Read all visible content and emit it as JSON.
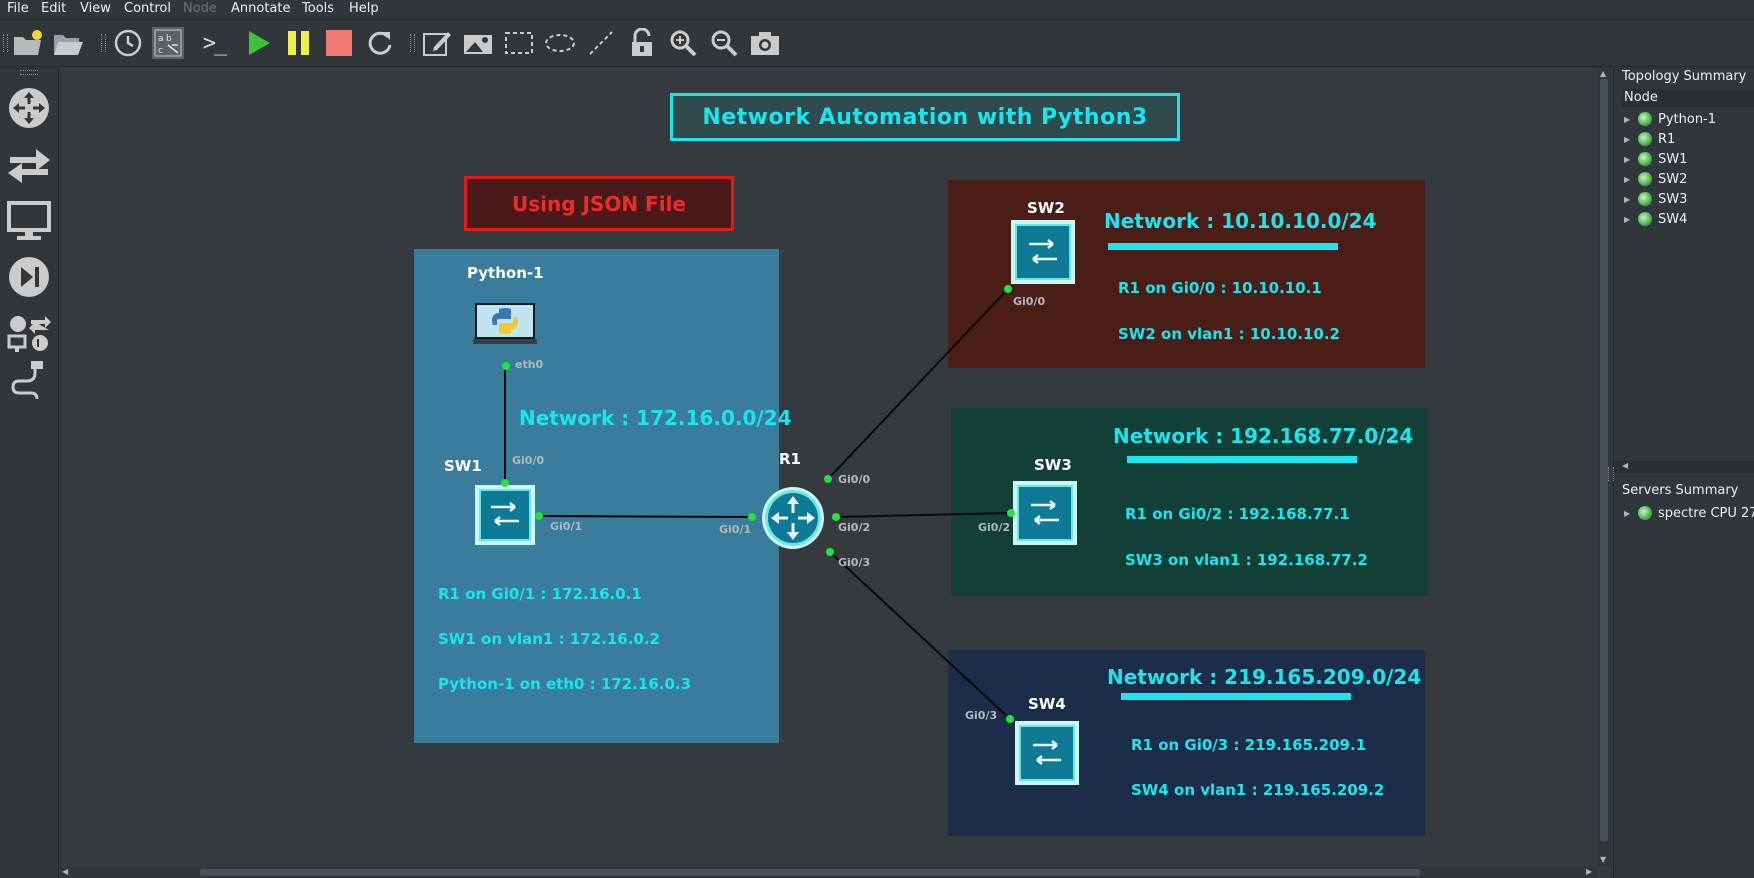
{
  "menu": {
    "file": "File",
    "edit": "Edit",
    "view": "View",
    "control": "Control",
    "node": "Node",
    "annotate": "Annotate",
    "tools": "Tools",
    "help": "Help"
  },
  "toolbar": {
    "console_label": ">_"
  },
  "diagram": {
    "main_title": "Network Automation with Python3",
    "subtitle": "Using JSON File",
    "zone1": {
      "network": "Network : 172.16.0.0/24",
      "line1": "R1 on Gi0/1 : 172.16.0.1",
      "line2": "SW1 on vlan1 : 172.16.0.2",
      "line3": "Python-1 on eth0 : 172.16.0.3"
    },
    "zone2": {
      "network": "Network : 10.10.10.0/24",
      "line1": "R1 on Gi0/0 : 10.10.10.1",
      "line2": "SW2 on vlan1 : 10.10.10.2"
    },
    "zone3": {
      "network": "Network : 192.168.77.0/24",
      "line1": "R1 on Gi0/2 : 192.168.77.1",
      "line2": "SW3 on vlan1 : 192.168.77.2"
    },
    "zone4": {
      "network": "Network : 219.165.209.0/24",
      "line1": "R1 on Gi0/3 : 219.165.209.1",
      "line2": "SW4 on vlan1 : 219.165.209.2"
    },
    "nodes": {
      "python": "Python-1",
      "sw1": "SW1",
      "r1": "R1",
      "sw2": "SW2",
      "sw3": "SW3",
      "sw4": "SW4"
    },
    "interfaces": {
      "py_eth0": "eth0",
      "sw1_gi00": "Gi0/0",
      "sw1_gi01": "Gi0/1",
      "r1_gi01": "Gi0/1",
      "r1_gi00": "Gi0/0",
      "r1_gi02": "Gi0/2",
      "r1_gi03": "Gi0/3",
      "sw2_gi00": "Gi0/0",
      "sw3_gi02": "Gi0/2",
      "sw4_gi03": "Gi0/3"
    },
    "colors": {
      "title_cyan": "#19e6ee",
      "zone1_bg": "#3a7c9b",
      "zone2_bg": "#4a1e17",
      "zone3_bg": "#123f36",
      "zone4_bg": "#1c2d49",
      "subtitle_red": "#e11919"
    }
  },
  "topology": {
    "title": "Topology Summary",
    "column": "Node",
    "nodes": [
      "Python-1",
      "R1",
      "SW1",
      "SW2",
      "SW3",
      "SW4"
    ]
  },
  "servers": {
    "title": "Servers Summary",
    "items": [
      "spectre CPU 27"
    ]
  }
}
